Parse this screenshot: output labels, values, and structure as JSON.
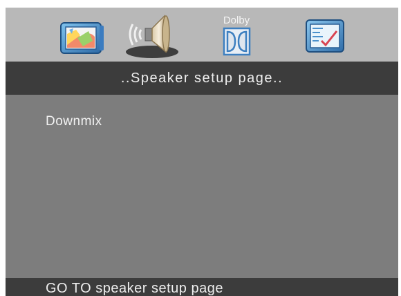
{
  "tabs": [
    {
      "name": "general-setup",
      "icon": "tv-screen-icon",
      "label": ""
    },
    {
      "name": "speaker-setup",
      "icon": "speaker-icon",
      "label": "",
      "selected": true
    },
    {
      "name": "dolby-setup",
      "icon": "dolby-logo-icon",
      "label": "Dolby"
    },
    {
      "name": "preference-setup",
      "icon": "checklist-icon",
      "label": ""
    }
  ],
  "page": {
    "title": "..Speaker setup page..",
    "items": [
      {
        "label": "Downmix"
      }
    ]
  },
  "status": {
    "text": "GO TO speaker setup page"
  },
  "colors": {
    "tabbar": "#b8b8b8",
    "title_bar": "#3c3c3c",
    "panel": "#7d7d7d",
    "text": "#eeeeee",
    "icon_blue": "#3d7fc0"
  }
}
